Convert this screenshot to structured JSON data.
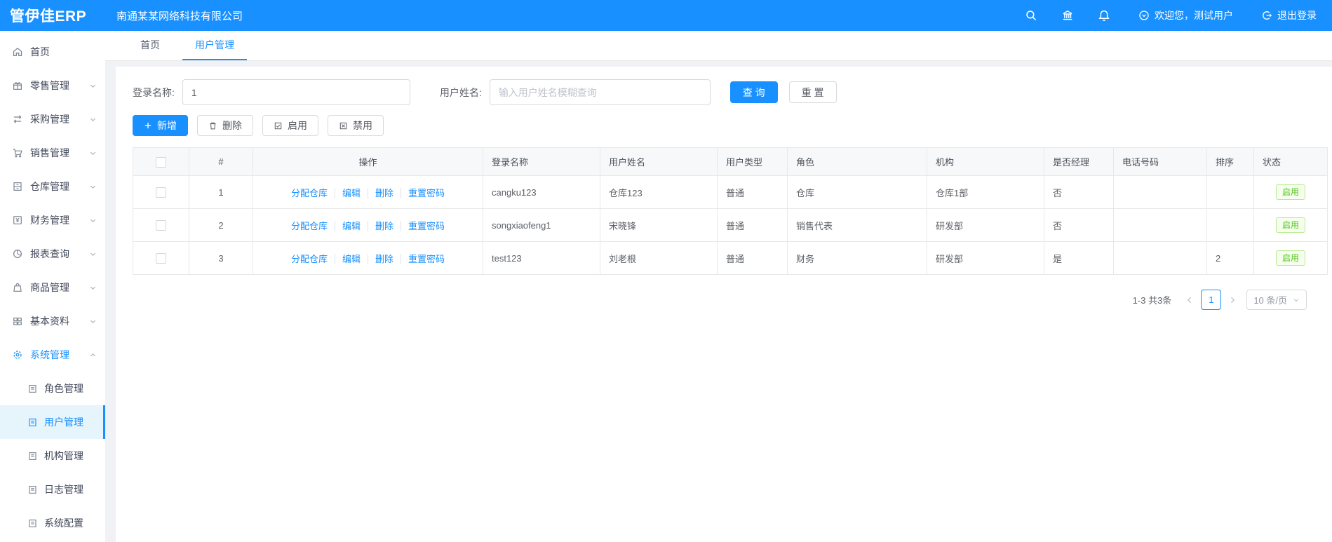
{
  "header": {
    "logo": "管伊佳ERP",
    "company": "南通某某网络科技有限公司",
    "welcome": "欢迎您，测试用户",
    "logout": "退出登录"
  },
  "sidebar": {
    "items": [
      {
        "label": "首页",
        "icon": "home-icon"
      },
      {
        "label": "零售管理",
        "icon": "gift-icon"
      },
      {
        "label": "采购管理",
        "icon": "swap-arrows-icon"
      },
      {
        "label": "销售管理",
        "icon": "cart-icon"
      },
      {
        "label": "仓库管理",
        "icon": "cabinet-icon"
      },
      {
        "label": "财务管理",
        "icon": "finance-icon"
      },
      {
        "label": "报表查询",
        "icon": "pie-chart-icon"
      },
      {
        "label": "商品管理",
        "icon": "bag-icon"
      },
      {
        "label": "基本资料",
        "icon": "grid-icon"
      },
      {
        "label": "系统管理",
        "icon": "gear-icon",
        "active": true,
        "expanded": true
      }
    ],
    "sub_items": [
      {
        "label": "角色管理"
      },
      {
        "label": "用户管理",
        "active": true
      },
      {
        "label": "机构管理"
      },
      {
        "label": "日志管理"
      },
      {
        "label": "系统配置"
      }
    ]
  },
  "tabs": [
    {
      "label": "首页"
    },
    {
      "label": "用户管理",
      "active": true
    }
  ],
  "search_form": {
    "login_name_label": "登录名称:",
    "login_name_value": "1",
    "user_name_label": "用户姓名:",
    "user_name_placeholder": "输入用户姓名模糊查询",
    "query_button": "查 询",
    "reset_button": "重 置"
  },
  "toolbar": {
    "add": "新增",
    "delete": "删除",
    "enable": "启用",
    "disable": "禁用"
  },
  "table": {
    "columns": [
      "#",
      "操作",
      "登录名称",
      "用户姓名",
      "用户类型",
      "角色",
      "机构",
      "是否经理",
      "电话号码",
      "排序",
      "状态"
    ],
    "action_links": [
      "分配仓库",
      "编辑",
      "删除",
      "重置密码"
    ],
    "rows": [
      {
        "index": "1",
        "login": "cangku123",
        "name": "仓库123",
        "type": "普通",
        "role": "仓库",
        "org": "仓库1部",
        "is_manager": "否",
        "phone": "",
        "sort": "",
        "status": "启用"
      },
      {
        "index": "2",
        "login": "songxiaofeng1",
        "name": "宋晓锋",
        "type": "普通",
        "role": "销售代表",
        "org": "研发部",
        "is_manager": "否",
        "phone": "",
        "sort": "",
        "status": "启用"
      },
      {
        "index": "3",
        "login": "test123",
        "name": "刘老根",
        "type": "普通",
        "role": "财务",
        "org": "研发部",
        "is_manager": "是",
        "phone": "",
        "sort": "2",
        "status": "启用"
      }
    ]
  },
  "pagination": {
    "total": "1-3 共3条",
    "current_page": "1",
    "page_size": "10 条/页"
  },
  "colors": {
    "primary": "#1890ff",
    "success_text": "#52c41a",
    "success_border": "#b7eb8f",
    "success_bg": "#f6ffed"
  }
}
